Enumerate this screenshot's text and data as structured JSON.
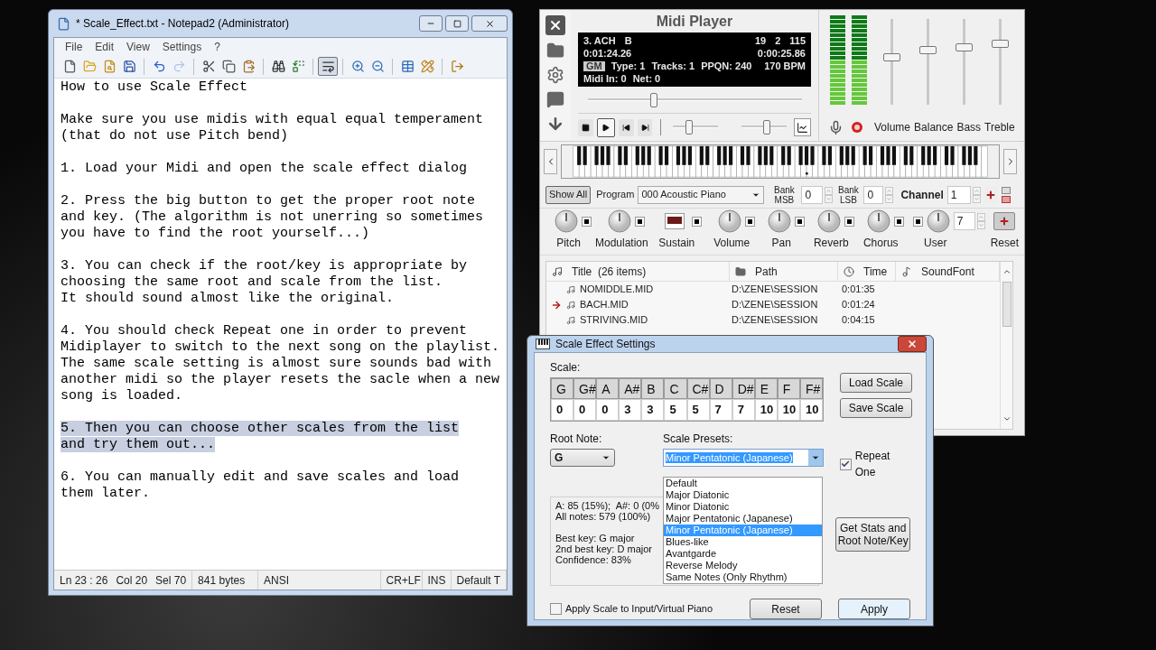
{
  "notepad": {
    "title": "* Scale_Effect.txt - Notepad2 (Administrator)",
    "menu": [
      "File",
      "Edit",
      "View",
      "Settings",
      "?"
    ],
    "toolbar": [
      [
        {
          "kind": "new",
          "selected": false,
          "disabled": false
        },
        {
          "kind": "open",
          "selected": false,
          "disabled": false
        },
        {
          "kind": "browse",
          "selected": false,
          "disabled": false
        },
        {
          "kind": "save",
          "selected": false,
          "disabled": false
        }
      ],
      [
        {
          "kind": "undo",
          "selected": false,
          "disabled": false
        },
        {
          "kind": "redo",
          "selected": false,
          "disabled": true
        }
      ],
      [
        {
          "kind": "cut",
          "selected": false,
          "disabled": false
        },
        {
          "kind": "copy",
          "selected": false,
          "disabled": false
        },
        {
          "kind": "paste",
          "selected": false,
          "disabled": false
        }
      ],
      [
        {
          "kind": "find",
          "selected": false,
          "disabled": false
        },
        {
          "kind": "replace",
          "selected": false,
          "disabled": false
        }
      ],
      [
        {
          "kind": "wrap",
          "selected": true,
          "disabled": false
        }
      ],
      [
        {
          "kind": "zoom_in",
          "selected": false,
          "disabled": false
        },
        {
          "kind": "zoom_out",
          "selected": false,
          "disabled": false
        }
      ],
      [
        {
          "kind": "scheme",
          "selected": false,
          "disabled": false
        },
        {
          "kind": "customize",
          "selected": false,
          "disabled": false
        }
      ],
      [
        {
          "kind": "exit",
          "selected": false,
          "disabled": false
        }
      ]
    ],
    "paragraphs": [
      {
        "lines": [
          "How to use Scale Effect"
        ],
        "selected": false
      },
      {
        "lines": [
          "Make sure you use midis with equal equal temperament",
          "(that do not use Pitch bend)"
        ],
        "selected": false
      },
      {
        "lines": [
          "1. Load your Midi and open the scale effect dialog"
        ],
        "selected": false
      },
      {
        "lines": [
          "2. Press the big button to get the proper root note",
          "and key. (The algorithm is not unerring so sometimes",
          "you have to find the root yourself...)"
        ],
        "selected": false
      },
      {
        "lines": [
          "3. You can check if the root/key is appropriate by",
          "choosing the same root and scale from the list.",
          "It should sound almost like the original."
        ],
        "selected": false
      },
      {
        "lines": [
          "4. You should check Repeat one in order to prevent",
          "Midiplayer to switch to the next song on the playlist.",
          "The same scale setting is almost sure sounds bad with",
          "another midi so the player resets the sacle when a new",
          "song is loaded."
        ],
        "selected": false
      },
      {
        "lines": [
          "5. Then you can choose other scales from the list",
          "and try them out..."
        ],
        "selected": true
      },
      {
        "lines": [
          "6. You can manually edit and save scales and load",
          "them later."
        ],
        "selected": false
      }
    ],
    "status_bar": [
      [
        "Ln 23 : 26",
        "Col 20",
        "Sel 70"
      ],
      [
        "841 bytes"
      ],
      [
        "ANSI"
      ],
      [
        "CR+LF"
      ],
      [
        "INS"
      ],
      [
        "Default T"
      ]
    ]
  },
  "midi_player": {
    "title": "Midi Player",
    "display": {
      "song": [
        "3. ACH",
        "B"
      ],
      "counters": [
        "19",
        "2",
        "115"
      ],
      "elapsed": "0:01:24.26",
      "remaining": "0:00:25.86",
      "badge": "GM",
      "info": [
        "Type: 1",
        "Tracks: 1",
        "PPQN: 240"
      ],
      "tempo": "170 BPM",
      "status": [
        "Midi In: 0",
        "Net: 0"
      ]
    },
    "position": {
      "level": 0.31
    },
    "transport": [
      {
        "kind": "stop",
        "selected": false
      },
      {
        "kind": "play",
        "selected": true
      },
      {
        "kind": "previous",
        "selected": false
      },
      {
        "kind": "next",
        "selected": false
      }
    ],
    "small_sliders": [
      {
        "level": 0.35
      },
      {
        "level": 0.55
      }
    ],
    "mixer": [
      {
        "label": "Volume",
        "level": 0.55
      },
      {
        "label": "Balance",
        "level": 0.63
      },
      {
        "label": "Bass",
        "level": 0.66
      },
      {
        "label": "Treble",
        "level": 0.71
      }
    ],
    "show_all": {
      "label": "Show All",
      "selected": true
    },
    "program_label": "Program",
    "program": "000 Acoustic Piano",
    "bank_msb_label": "Bank MSB",
    "bank_msb": "0",
    "bank_lsb_label": "Bank LSB",
    "bank_lsb": "0",
    "channel_label": "Channel",
    "channel": "1",
    "controllers": [
      {
        "kind": "knob",
        "label": "Pitch"
      },
      {
        "kind": "knob",
        "label": "Modulation"
      },
      {
        "kind": "switch",
        "label": "Sustain",
        "on": true
      },
      {
        "kind": "knob",
        "label": "Volume"
      },
      {
        "kind": "knob",
        "label": "Pan"
      },
      {
        "kind": "knob",
        "label": "Reverb"
      },
      {
        "kind": "knob",
        "label": "Chorus"
      },
      {
        "kind": "user",
        "label": "User",
        "value": "7"
      },
      {
        "kind": "reset",
        "label": "Reset"
      }
    ],
    "playlist": {
      "columns": [
        "Title  (26 items)",
        "Path",
        "Time",
        "SoundFont"
      ],
      "rows": [
        {
          "title": "NOMIDDLE.MID",
          "path": "D:\\ZENE\\SESSION",
          "time": "0:01:35",
          "playing": false
        },
        {
          "title": "BACH.MID",
          "path": "D:\\ZENE\\SESSION",
          "time": "0:01:24",
          "playing": true
        },
        {
          "title": "STRIVING.MID",
          "path": "D:\\ZENE\\SESSION",
          "time": "0:04:15",
          "playing": false
        }
      ]
    }
  },
  "scale_dialog": {
    "title": "Scale Effect Settings",
    "scale_label": "Scale:",
    "notes": [
      "G",
      "G#",
      "A",
      "A#",
      "B",
      "C",
      "C#",
      "D",
      "D#",
      "E",
      "F",
      "F#"
    ],
    "values": [
      "0",
      "0",
      "0",
      "3",
      "3",
      "5",
      "5",
      "7",
      "7",
      "10",
      "10",
      "10"
    ],
    "load_button": "Load Scale",
    "save_button": "Save Scale",
    "root_label": "Root Note:",
    "root": "G",
    "presets_label": "Scale Presets:",
    "preset": "Minor Pentatonic (Japanese)",
    "options": [
      {
        "label": "Default",
        "selected": false
      },
      {
        "label": "Major Diatonic",
        "selected": false
      },
      {
        "label": "Minor Diatonic",
        "selected": false
      },
      {
        "label": "Major Pentatonic (Japanese)",
        "selected": false
      },
      {
        "label": "Minor Pentatonic (Japanese)",
        "selected": true
      },
      {
        "label": "Blues-like",
        "selected": false
      },
      {
        "label": "Avantgarde",
        "selected": false
      },
      {
        "label": "Reverse Melody",
        "selected": false
      },
      {
        "label": "Same Notes (Only Rhythm)",
        "selected": false
      }
    ],
    "repeat_one": {
      "label": "Repeat One",
      "checked": true
    },
    "stats": [
      [
        "A: 85 (15%);  A#: 0 (0%",
        "All notes: 579 (100%)"
      ],
      [
        "Best key: G major",
        "2nd best key: D major",
        "Confidence: 83%"
      ]
    ],
    "stats_button": "Get Stats and Root Note/Key",
    "apply_to_input": {
      "label": "Apply Scale to Input/Virtual Piano",
      "checked": false
    },
    "reset_button": "Reset",
    "apply_button": "Apply"
  }
}
